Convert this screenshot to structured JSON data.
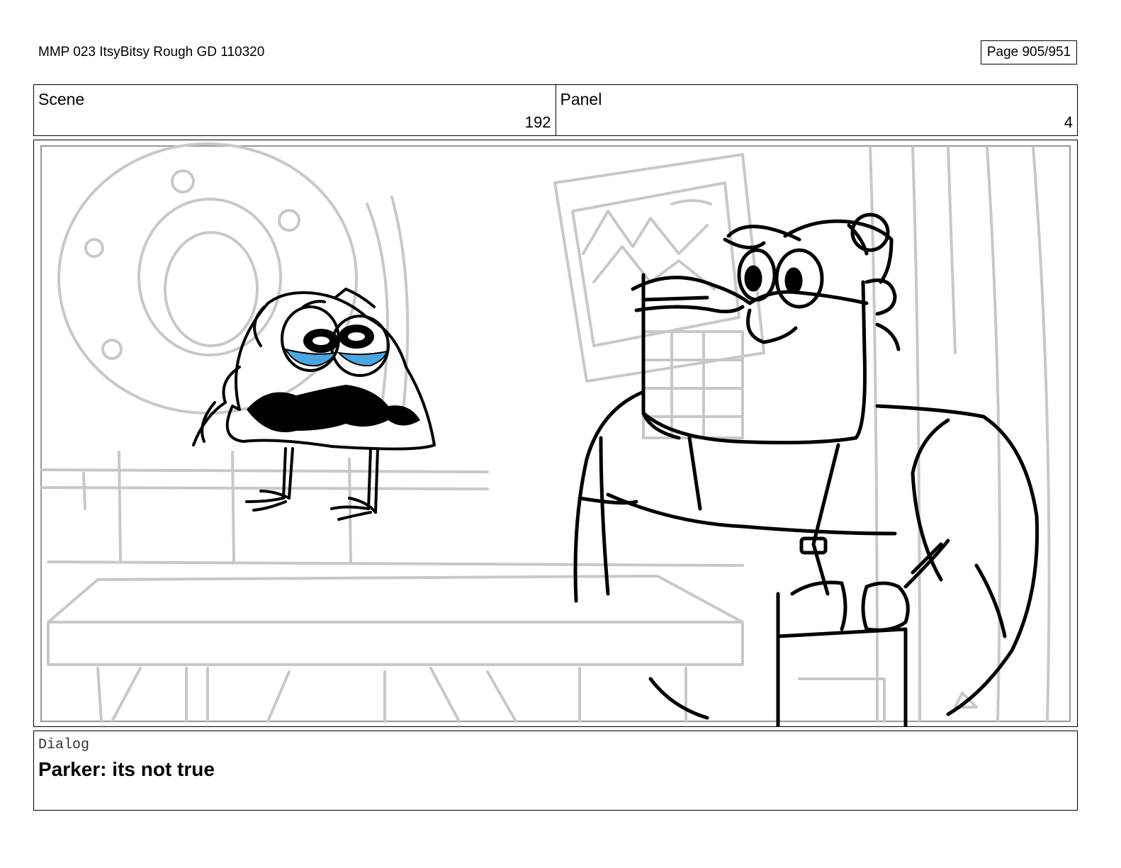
{
  "header": {
    "doc_title": "MMP 023 ItsyBitsy Rough GD 110320",
    "page_label": "Page 905/951"
  },
  "info": {
    "scene_label": "Scene",
    "scene_value": "192",
    "panel_label": "Panel",
    "panel_value": "4"
  },
  "dialog": {
    "label": "Dialog",
    "text": "Parker: its not true"
  },
  "colors": {
    "tears": "#4aa6e0",
    "background_lines": "#c8c8c8"
  }
}
